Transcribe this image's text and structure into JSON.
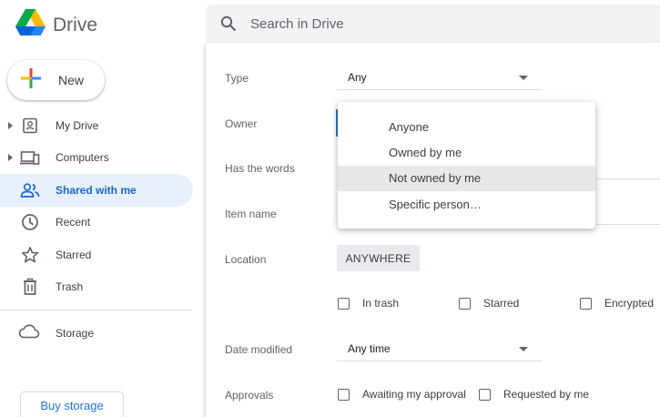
{
  "app": {
    "name": "Drive"
  },
  "sidebar": {
    "new_label": "New",
    "items": [
      {
        "label": "My Drive",
        "icon": "my-drive-icon",
        "expandable": true,
        "active": false
      },
      {
        "label": "Computers",
        "icon": "computers-icon",
        "expandable": true,
        "active": false
      },
      {
        "label": "Shared with me",
        "icon": "shared-with-me-icon",
        "expandable": false,
        "active": true
      },
      {
        "label": "Recent",
        "icon": "clock-icon",
        "expandable": false,
        "active": false
      },
      {
        "label": "Starred",
        "icon": "star-icon",
        "expandable": false,
        "active": false
      },
      {
        "label": "Trash",
        "icon": "trash-icon",
        "expandable": false,
        "active": false
      }
    ],
    "storage_label": "Storage",
    "buy_storage_label": "Buy storage"
  },
  "search": {
    "placeholder": "Search in Drive",
    "fields": {
      "type_label": "Type",
      "type_value": "Any",
      "owner_label": "Owner",
      "has_words_label": "Has the words",
      "item_name_label": "Item name",
      "location_label": "Location",
      "location_button": "ANYWHERE",
      "in_trash_label": "In trash",
      "starred_label": "Starred",
      "encrypted_label": "Encrypted",
      "date_modified_label": "Date modified",
      "date_modified_value": "Any time",
      "approvals_label": "Approvals",
      "awaiting_label": "Awaiting my approval",
      "requested_label": "Requested by me"
    },
    "owner_menu": {
      "options": [
        "Anyone",
        "Owned by me",
        "Not owned by me",
        "Specific person…"
      ],
      "highlighted": "Not owned by me"
    }
  },
  "colors": {
    "accent": "#1a73e8",
    "active_bg": "#e8f0fe",
    "active_text": "#1967d2"
  }
}
